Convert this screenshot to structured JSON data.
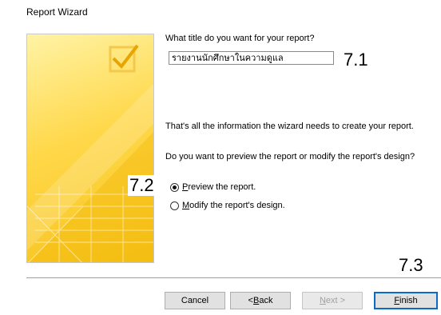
{
  "window": {
    "title": "Report Wizard"
  },
  "form": {
    "question": "What title do you want for your report?",
    "report_title_value": "รายงานนักศึกษาในความดูแล",
    "info_line": "That's all the information the wizard needs to create your report.",
    "preview_question": "Do you want to preview the report or modify the report's design?",
    "options": [
      {
        "mnemonic": "P",
        "rest": "review the report.",
        "selected": true
      },
      {
        "mnemonic": "M",
        "rest": "odify the report's design.",
        "selected": false
      }
    ]
  },
  "buttons": {
    "cancel": "Cancel",
    "back_prefix": "< ",
    "back_mnemonic": "B",
    "back_rest": "ack",
    "next_mnemonic": "N",
    "next_rest": "ext >",
    "finish_mnemonic": "F",
    "finish_rest": "inish"
  },
  "annotations": {
    "a1": "7.1",
    "a2": "7.2",
    "a3": "7.3"
  },
  "colors": {
    "image_yellow": "#f6c21a",
    "default_button_border": "#0a6ac8"
  }
}
